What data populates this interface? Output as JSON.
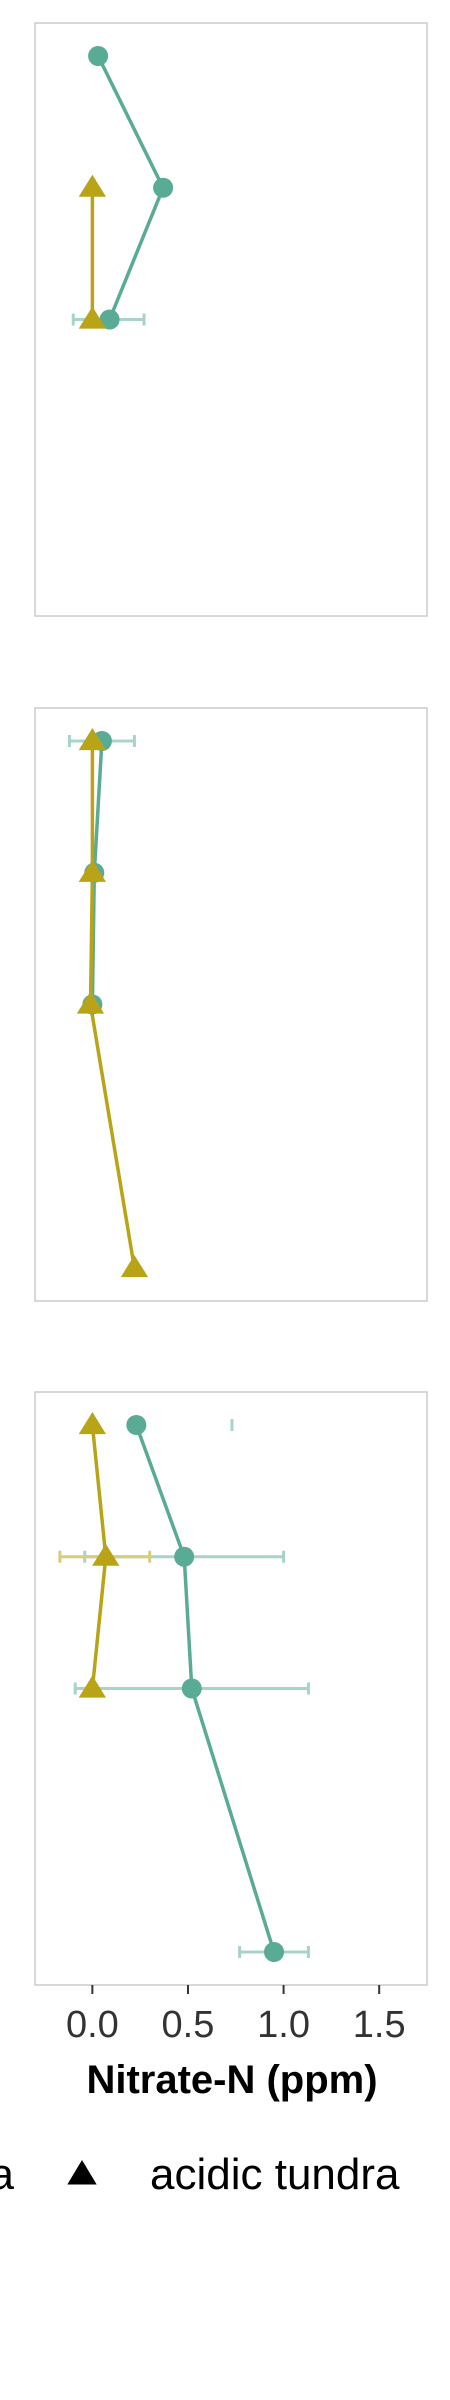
{
  "chart_data": {
    "type": "scatter",
    "xlabel": "Nitrate-N (ppm)",
    "xlim": [
      -0.3,
      1.75
    ],
    "xticks": [
      "0.0",
      "0.5",
      "1.0",
      "1.5"
    ],
    "xtick_values": [
      0.0,
      0.5,
      1.0,
      1.5
    ],
    "grid": false,
    "legend_position": "bottom",
    "legend": [
      {
        "label": "a",
        "marker": "circle",
        "color": "#5aab95"
      },
      {
        "label": "acidic tundra",
        "marker": "triangle",
        "color": "#b8a416"
      }
    ],
    "colors": {
      "teal": "#5aab95",
      "olive": "#b8a416",
      "teal_error": "#a8d4c8",
      "olive_error": "#d9cd7a"
    },
    "panels": [
      {
        "levels": 5,
        "series": [
          {
            "marker": "circle",
            "color": "#5aab95",
            "points": [
              {
                "level": 0,
                "x": 0.03
              },
              {
                "level": 1,
                "x": 0.37
              },
              {
                "level": 2,
                "x": 0.09,
                "xerr": [
                  -0.1,
                  0.27
                ]
              }
            ]
          },
          {
            "marker": "triangle",
            "color": "#b8a416",
            "points": [
              {
                "level": 1,
                "x": 0.0
              },
              {
                "level": 2,
                "x": 0.0
              }
            ]
          }
        ]
      },
      {
        "levels": 5,
        "series": [
          {
            "marker": "circle",
            "color": "#5aab95",
            "points": [
              {
                "level": 0,
                "x": 0.05,
                "xerr": [
                  -0.12,
                  0.22
                ]
              },
              {
                "level": 1,
                "x": 0.01
              },
              {
                "level": 2,
                "x": 0.0
              }
            ]
          },
          {
            "marker": "triangle",
            "color": "#b8a416",
            "points": [
              {
                "level": 0,
                "x": 0.0
              },
              {
                "level": 1,
                "x": 0.0
              },
              {
                "level": 2,
                "x": -0.01
              },
              {
                "level": 4,
                "x": 0.22
              }
            ]
          }
        ]
      },
      {
        "levels": 5,
        "series": [
          {
            "marker": "circle",
            "color": "#5aab95",
            "points": [
              {
                "level": 0,
                "x": 0.23,
                "xerr_cap": 0.73
              },
              {
                "level": 1,
                "x": 0.48,
                "xerr": [
                  -0.04,
                  1.0
                ]
              },
              {
                "level": 2,
                "x": 0.52,
                "xerr": [
                  -0.09,
                  1.13
                ]
              },
              {
                "level": 4,
                "x": 0.95,
                "xerr": [
                  0.77,
                  1.13
                ]
              }
            ]
          },
          {
            "marker": "triangle",
            "color": "#b8a416",
            "points": [
              {
                "level": 0,
                "x": 0.0
              },
              {
                "level": 1,
                "x": 0.07,
                "xerr": [
                  -0.17,
                  0.3
                ]
              },
              {
                "level": 2,
                "x": 0.0
              }
            ]
          }
        ]
      }
    ]
  }
}
